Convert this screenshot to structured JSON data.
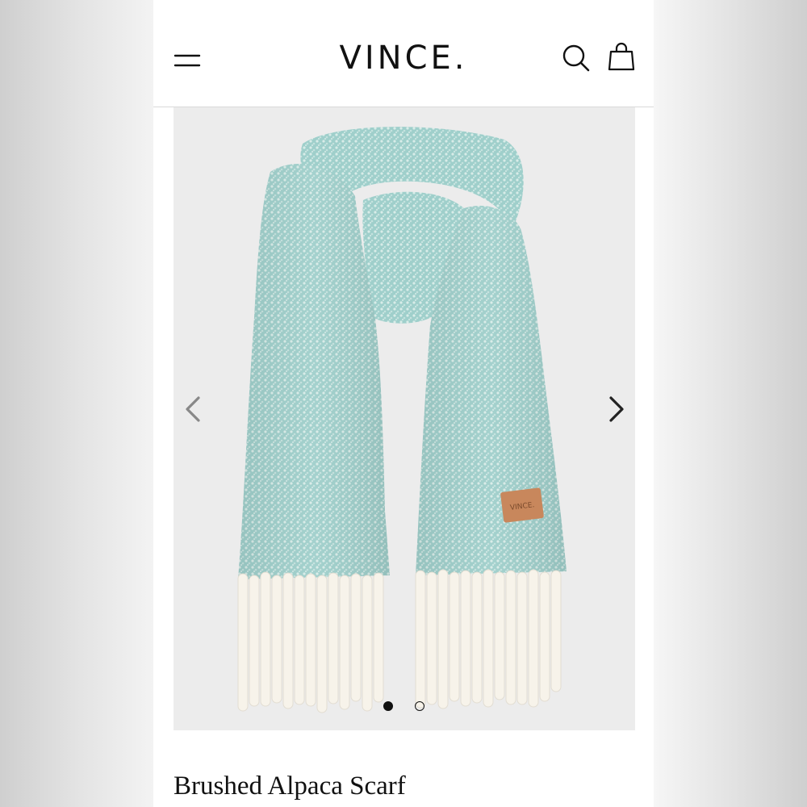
{
  "header": {
    "brand": "VINCE.",
    "icons": [
      "hamburger-menu-icon",
      "search-icon",
      "shopping-bag-icon"
    ]
  },
  "gallery": {
    "image_subject": "scarf-product-photo",
    "current_slide": 1,
    "total_slides": 2,
    "colors": {
      "scarf": "#9fcfcb",
      "fringe": "#f7f3ea",
      "label_patch": "#c8875c",
      "background": "#ececec"
    },
    "patch_text": "VINCE."
  },
  "product": {
    "title": "Brushed Alpaca Scarf"
  }
}
